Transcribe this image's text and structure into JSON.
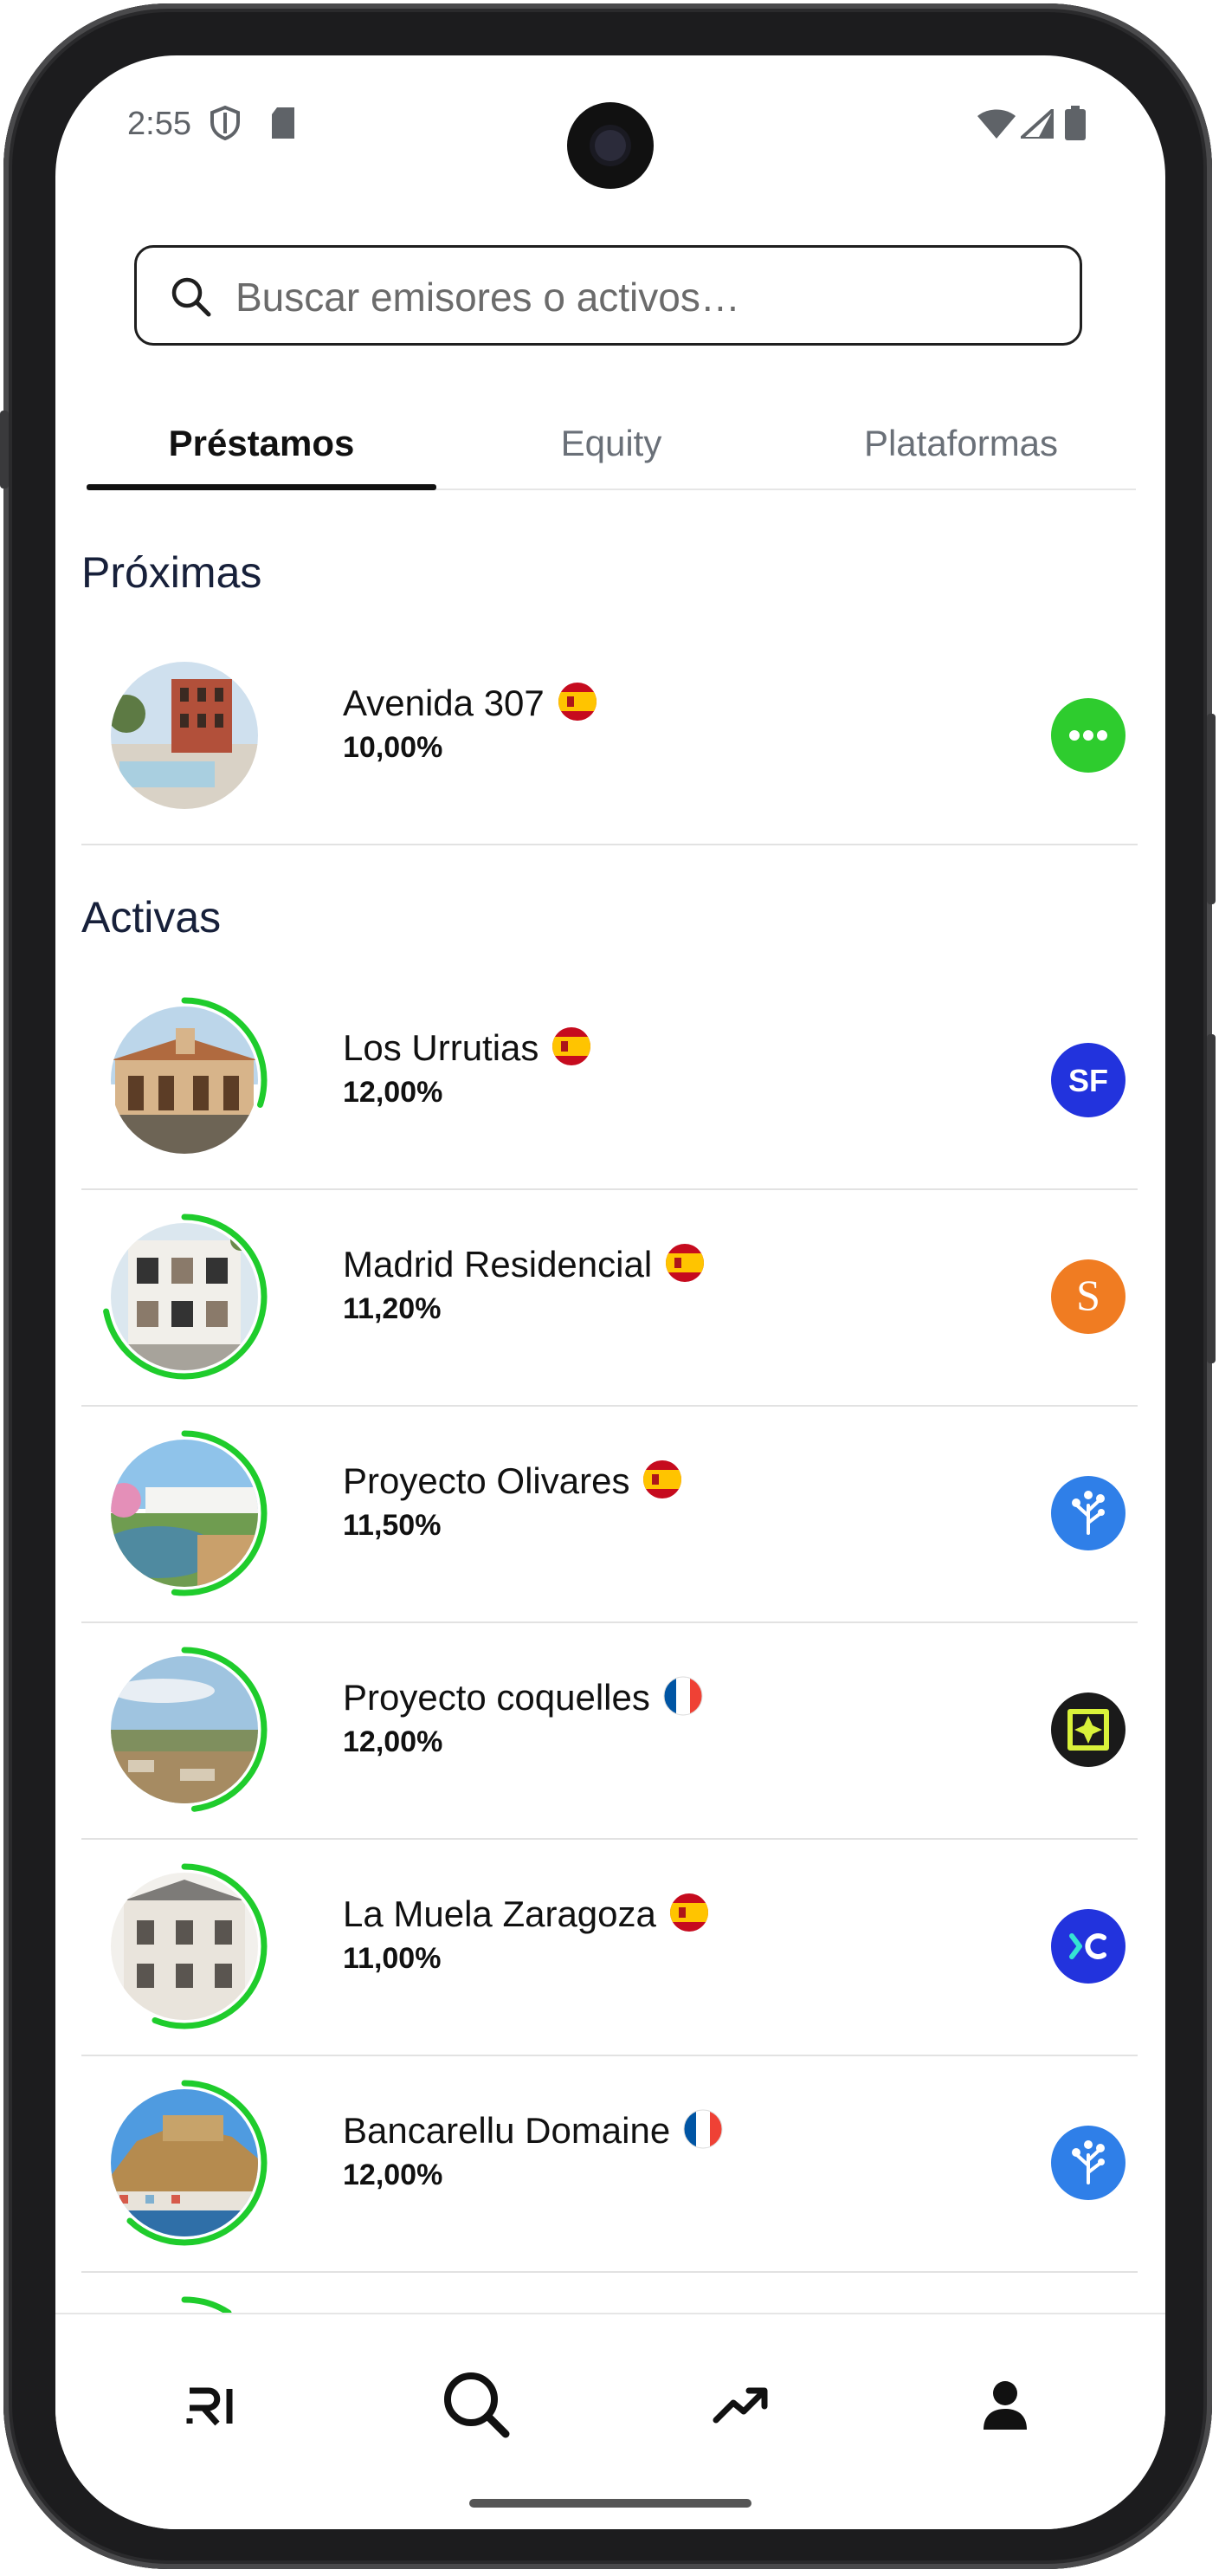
{
  "status_bar": {
    "time": "2:55"
  },
  "search": {
    "placeholder": "Buscar emisores o activos…"
  },
  "tabs": [
    {
      "label": "Préstamos",
      "active": true
    },
    {
      "label": "Equity",
      "active": false
    },
    {
      "label": "Plataformas",
      "active": false
    }
  ],
  "sections": {
    "upcoming_title": "Próximas",
    "active_title": "Activas"
  },
  "upcoming": [
    {
      "name": "Avenida 307",
      "rate": "10,00%",
      "flag": "es",
      "platform_icon": "more-dots-icon",
      "platform_color": "#2ecc2e"
    }
  ],
  "active": [
    {
      "name": "Los Urrutias",
      "rate": "12,00%",
      "flag": "es",
      "platform_icon": "sf-logo",
      "platform_color": "#2233dd",
      "progress": 0.3
    },
    {
      "name": "Madrid Residencial",
      "rate": "11,20%",
      "flag": "es",
      "platform_icon": "s-logo",
      "platform_color": "#f07c22",
      "progress": 0.72
    },
    {
      "name": "Proyecto Olivares",
      "rate": "11,50%",
      "flag": "es",
      "platform_icon": "tree-logo",
      "platform_color": "#2f7fe8",
      "progress": 0.52
    },
    {
      "name": "Proyecto coquelles",
      "rate": "12,00%",
      "flag": "fr",
      "platform_icon": "diamond-logo",
      "platform_color": "#1a1a1a",
      "progress": 0.48
    },
    {
      "name": "La Muela Zaragoza",
      "rate": "11,00%",
      "flag": "es",
      "platform_icon": "xc-logo",
      "platform_color": "#2233dd",
      "progress": 0.56
    },
    {
      "name": "Bancarellu Domaine",
      "rate": "12,00%",
      "flag": "fr",
      "platform_icon": "tree-logo",
      "platform_color": "#2f7fe8",
      "progress": 0.62
    }
  ],
  "bottom_nav": [
    {
      "name": "home",
      "icon": "ri-logo"
    },
    {
      "name": "search",
      "icon": "search-icon"
    },
    {
      "name": "portfolio",
      "icon": "trending-up-icon"
    },
    {
      "name": "profile",
      "icon": "person-icon"
    }
  ],
  "colors": {
    "accent_green": "#1fcc2c",
    "text_dark": "#111111",
    "tab_inactive": "#6a7078"
  }
}
